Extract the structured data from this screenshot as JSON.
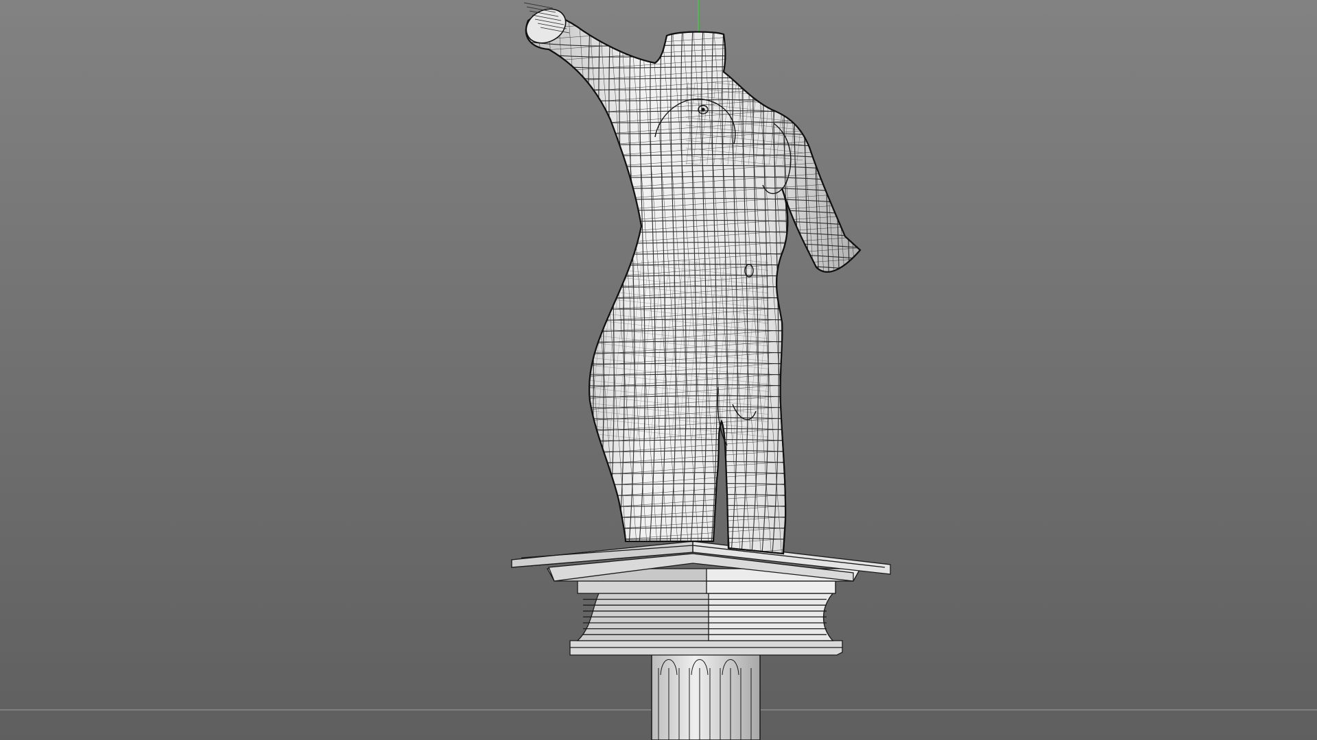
{
  "viewport": {
    "colors": {
      "background_top": "#828282",
      "background_bottom": "#5f5f5f",
      "mesh_fill": "#dcdcdc",
      "mesh_shadow": "#9a9a9a",
      "wire": "#1a1a1a",
      "horizon": "#8c8c8c",
      "axis_y": "#3ccc3c"
    },
    "objects": [
      {
        "name": "torso-wireframe-mesh"
      },
      {
        "name": "pedestal-capital-mesh"
      },
      {
        "name": "fluted-column-mesh"
      }
    ]
  }
}
